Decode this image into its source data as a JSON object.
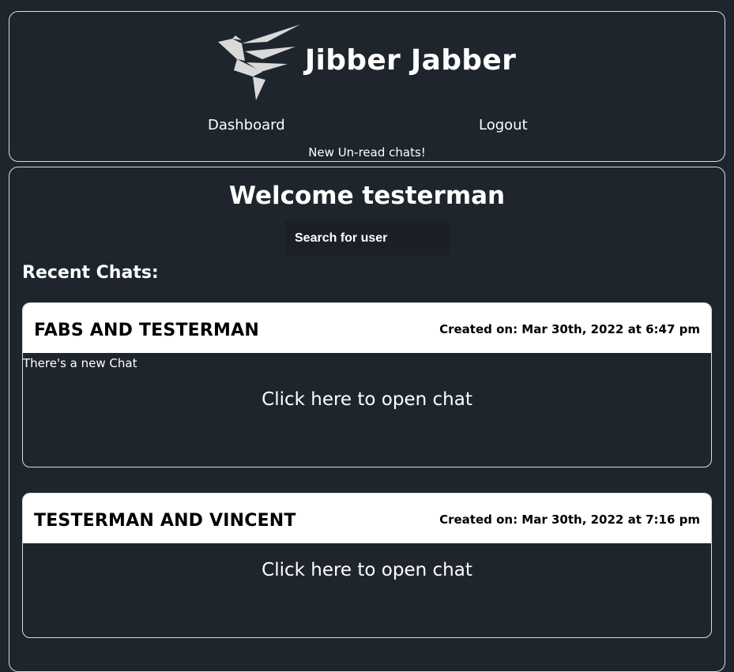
{
  "header": {
    "title": "Jibber Jabber",
    "logo_icon": "bird-logo-icon",
    "nav": {
      "dashboard": "Dashboard",
      "logout": "Logout"
    },
    "notice": "New Un-read chats!"
  },
  "main": {
    "welcome": "Welcome testerman",
    "search_placeholder": "Search for user",
    "recent_title": "Recent Chats:",
    "chats": [
      {
        "title": "FABS AND TESTERMAN",
        "created": "Created on: Mar 30th, 2022 at 6:47 pm",
        "new_message": "There's a new Chat",
        "open_label": "Click here to open chat"
      },
      {
        "title": "TESTERMAN AND VINCENT",
        "created": "Created on: Mar 30th, 2022 at 7:16 pm",
        "open_label": "Click here to open chat"
      }
    ]
  },
  "colors": {
    "background": "#1f252d",
    "border": "#d9dde2",
    "card_header": "#ffffff",
    "search_bg": "#1b2028"
  }
}
